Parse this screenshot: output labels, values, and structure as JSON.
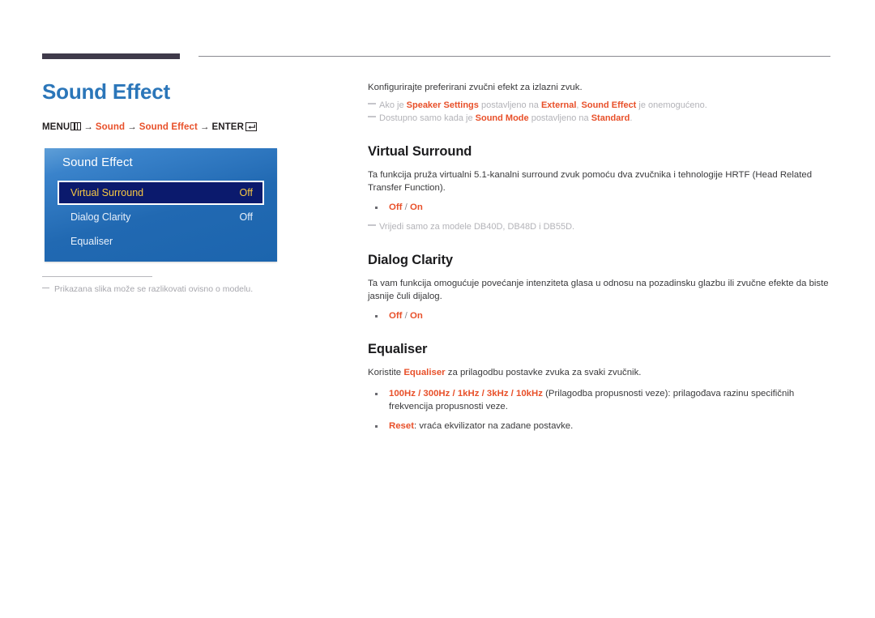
{
  "page": {
    "title": "Sound Effect",
    "accent_blue": "#2b76b9",
    "accent_orange": "#e8502a"
  },
  "breadcrumb": {
    "menu_label": "MENU",
    "menu_icon": "menu-grid-icon",
    "arrow": "→",
    "step1": "Sound",
    "step2": "Sound Effect",
    "enter_label": "ENTER",
    "enter_icon": "enter-arrow-icon"
  },
  "osd": {
    "title": "Sound Effect",
    "rows": [
      {
        "label": "Virtual Surround",
        "value": "Off",
        "selected": true
      },
      {
        "label": "Dialog Clarity",
        "value": "Off",
        "selected": false
      },
      {
        "label": "Equaliser",
        "value": "",
        "selected": false
      }
    ],
    "highlight_bg": "#0b1a6d",
    "highlight_text": "#f7c843"
  },
  "left_note": {
    "dash": "–",
    "text": "Prikazana slika može se razlikovati ovisno o modelu."
  },
  "intro": {
    "lead": "Konfigurirajte preferirani zvučni efekt za izlazni zvuk.",
    "memo1": {
      "t1": "Ako je ",
      "b1": "Speaker Settings",
      "t2": " postavljeno na ",
      "b2": "External",
      "t3": ", ",
      "b3": "Sound Effect",
      "t4": " je onemogućeno."
    },
    "memo2": {
      "t1": "Dostupno samo kada je ",
      "b1": "Sound Mode",
      "t2": " postavljeno na ",
      "b2": "Standard",
      "t3": "."
    }
  },
  "sections": [
    {
      "heading": "Virtual Surround",
      "body": "Ta funkcija pruža virtualni 5.1-kanalni surround zvuk pomoću dva zvučnika i tehnologije HRTF (Head Related Transfer Function).",
      "option_off": "Off",
      "option_sep": " / ",
      "option_on": "On",
      "memo": "Vrijedi samo za modele DB40D, DB48D i DB55D."
    },
    {
      "heading": "Dialog Clarity",
      "body": "Ta vam funkcija omogućuje povećanje intenziteta glasa u odnosu na pozadinsku glazbu ili zvučne efekte da biste jasnije čuli dijalog.",
      "option_off": "Off",
      "option_sep": " / ",
      "option_on": "On"
    }
  ],
  "equaliser": {
    "heading": "Equaliser",
    "body_pre": "Koristite ",
    "body_bold": "Equaliser",
    "body_post": " za prilagodbu postavke zvuka za svaki zvučnik.",
    "bullet1_bold": "100Hz / 300Hz / 1kHz / 3kHz / 10kHz",
    "bullet1_rest": " (Prilagodba propusnosti veze): prilagođava razinu specifičnih frekvencija propusnosti veze.",
    "bullet2_bold": "Reset",
    "bullet2_rest": ": vraća ekvilizator na zadane postavke."
  }
}
